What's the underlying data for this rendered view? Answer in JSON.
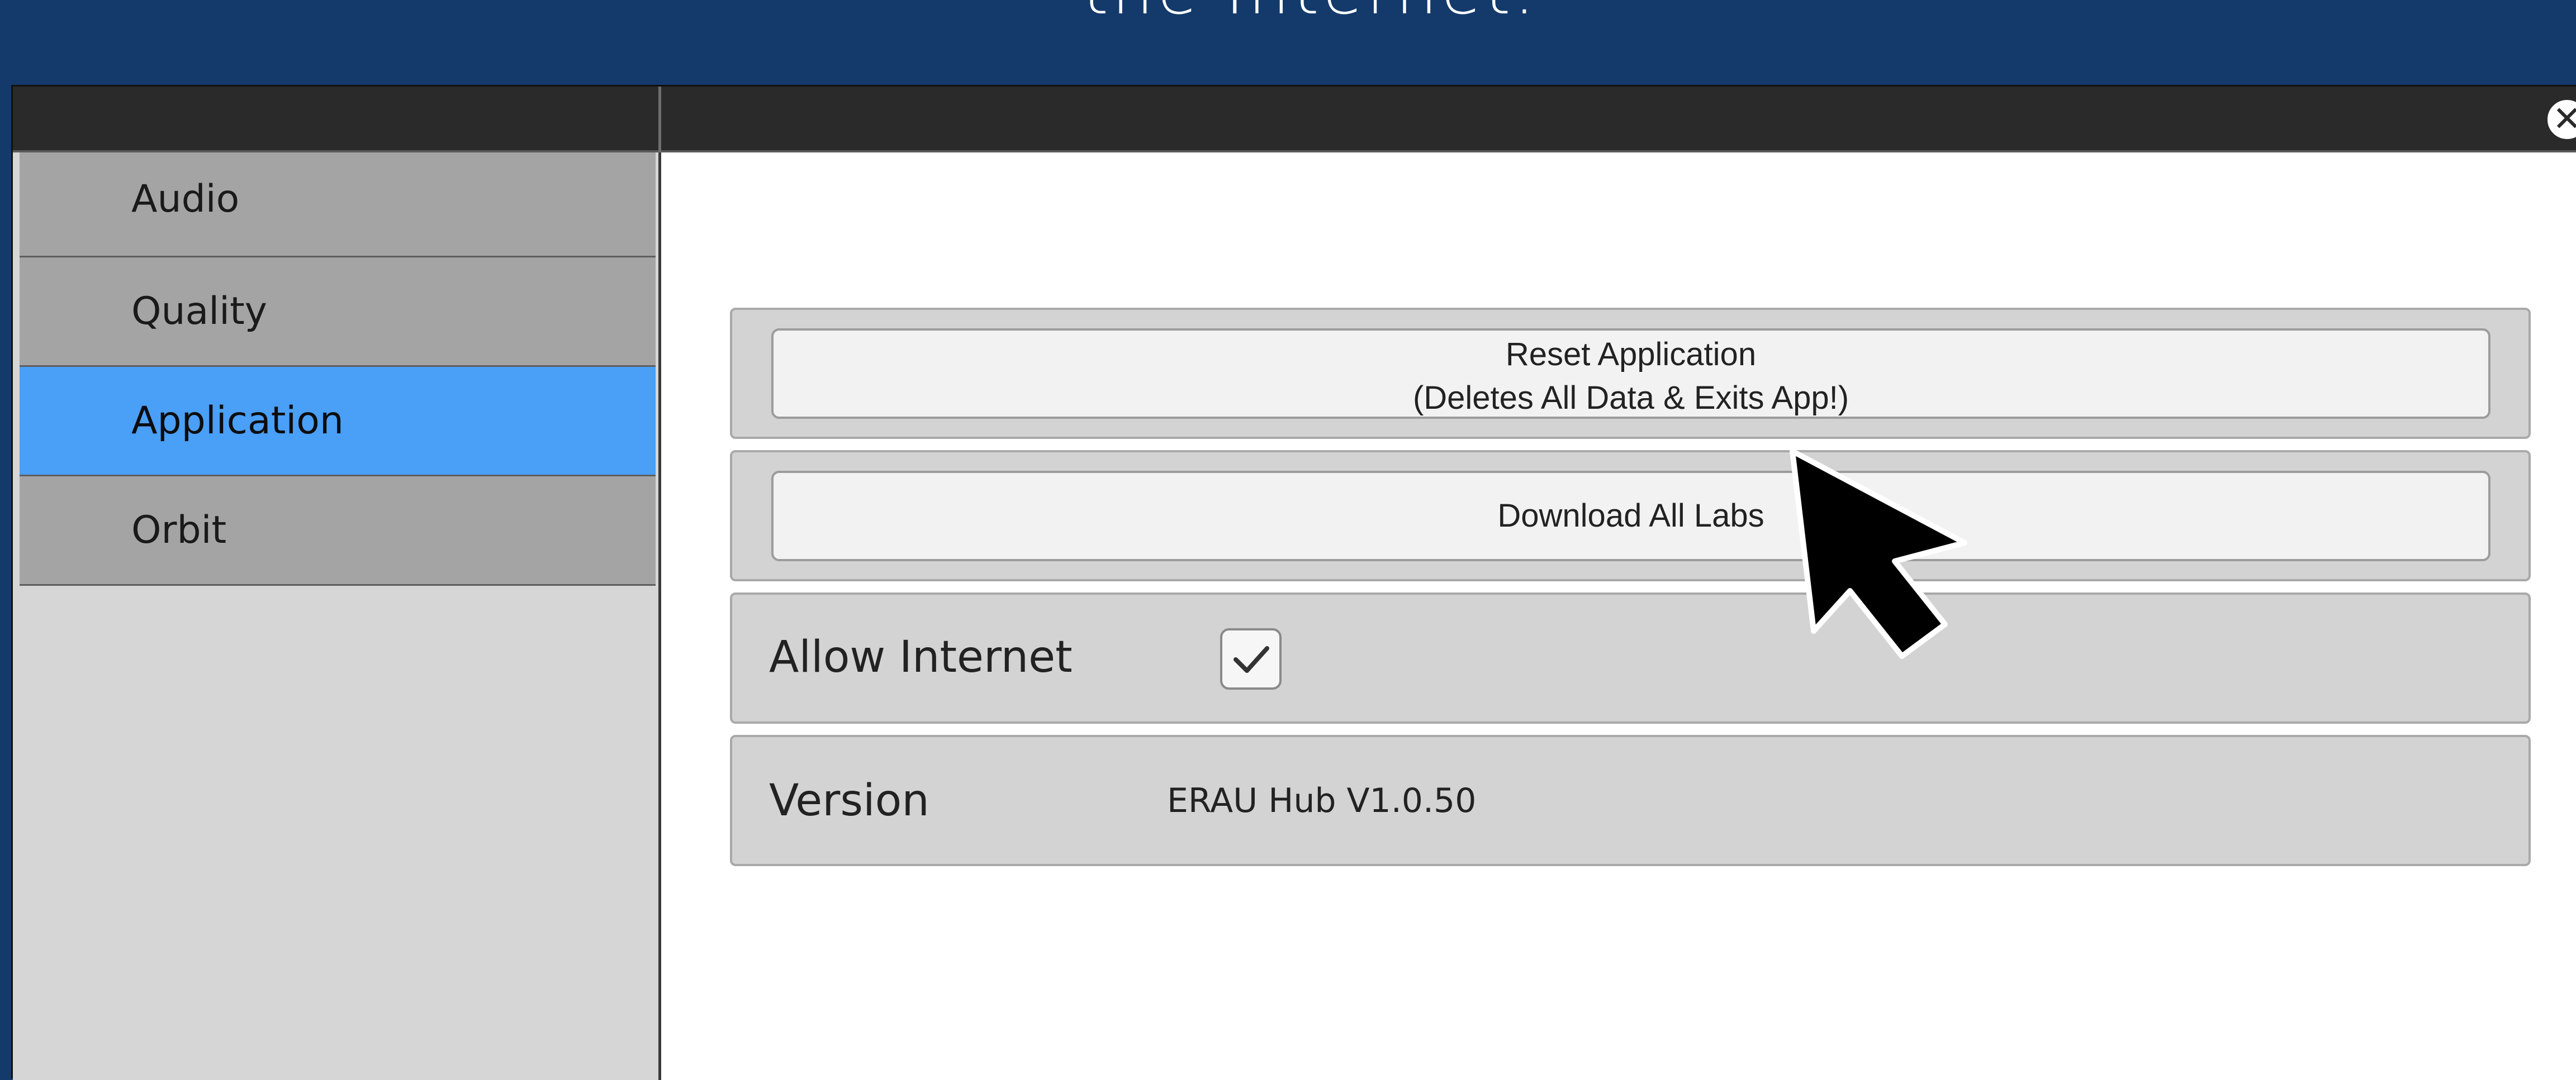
{
  "banner": {
    "text": "the Internet."
  },
  "dialog": {
    "close_symbol": "✕",
    "close_icon": "close-circle-icon"
  },
  "sidebar": {
    "items": [
      {
        "label": "Audio",
        "active": false
      },
      {
        "label": "Quality",
        "active": false
      },
      {
        "label": "Application",
        "active": true
      },
      {
        "label": "Orbit",
        "active": false
      }
    ],
    "active_color": "#4a9ff7"
  },
  "settings": {
    "reset_button": {
      "line1": "Reset Application",
      "line2": "(Deletes All Data & Exits App!)"
    },
    "download_button": {
      "label": "Download All Labs"
    },
    "allow_internet": {
      "label": "Allow Internet",
      "checked": true,
      "check_icon": "checkmark-icon"
    },
    "version": {
      "label": "Version",
      "value": "ERAU Hub V1.0.50"
    }
  },
  "pointer": {
    "icon": "mouse-cursor-icon"
  }
}
